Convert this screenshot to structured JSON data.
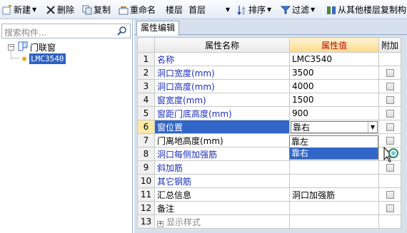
{
  "toolbar": {
    "new_label": "新建",
    "delete_label": "删除",
    "copy_label": "复制",
    "rename_label": "重命名",
    "floor_label": "楼层",
    "floor_value": "首层",
    "sort_label": "排序",
    "filter_label": "过滤",
    "copy_from_floor_label": "从其他楼层复制构"
  },
  "left_panel": {
    "search_placeholder": "搜索构件...",
    "tree_root": "门联窗",
    "tree_child": "LMC3540"
  },
  "right_panel": {
    "tab_label": "属性编辑",
    "headers": {
      "name": "属性名称",
      "value": "属性值",
      "extra": "附加"
    },
    "rows": [
      {
        "num": "1",
        "name": "名称",
        "value": "LMC3540"
      },
      {
        "num": "2",
        "name": "洞口宽度(mm)",
        "value": "3500"
      },
      {
        "num": "3",
        "name": "洞口高度(mm)",
        "value": "4000"
      },
      {
        "num": "4",
        "name": "窗宽度(mm)",
        "value": "1500"
      },
      {
        "num": "5",
        "name": "窗距门底高度(mm)",
        "value": "900"
      },
      {
        "num": "6",
        "name": "窗位置",
        "value": "靠右"
      },
      {
        "num": "7",
        "name": "门离地高度(mm)",
        "value": ""
      },
      {
        "num": "8",
        "name": "洞口每侧加强筋",
        "value": ""
      },
      {
        "num": "9",
        "name": "斜加筋",
        "value": ""
      },
      {
        "num": "10",
        "name": "其它钢筋",
        "value": ""
      },
      {
        "num": "11",
        "name": "汇总信息",
        "value": "洞口加强筋"
      },
      {
        "num": "12",
        "name": "备注",
        "value": ""
      },
      {
        "num": "13",
        "name": "显示样式",
        "value": ""
      }
    ],
    "dropdown_options": [
      "靠左",
      "靠右"
    ]
  },
  "colors": {
    "selection": "#3166c8",
    "property_blue": "#1d2fb5",
    "header_value_red": "#c00000"
  }
}
